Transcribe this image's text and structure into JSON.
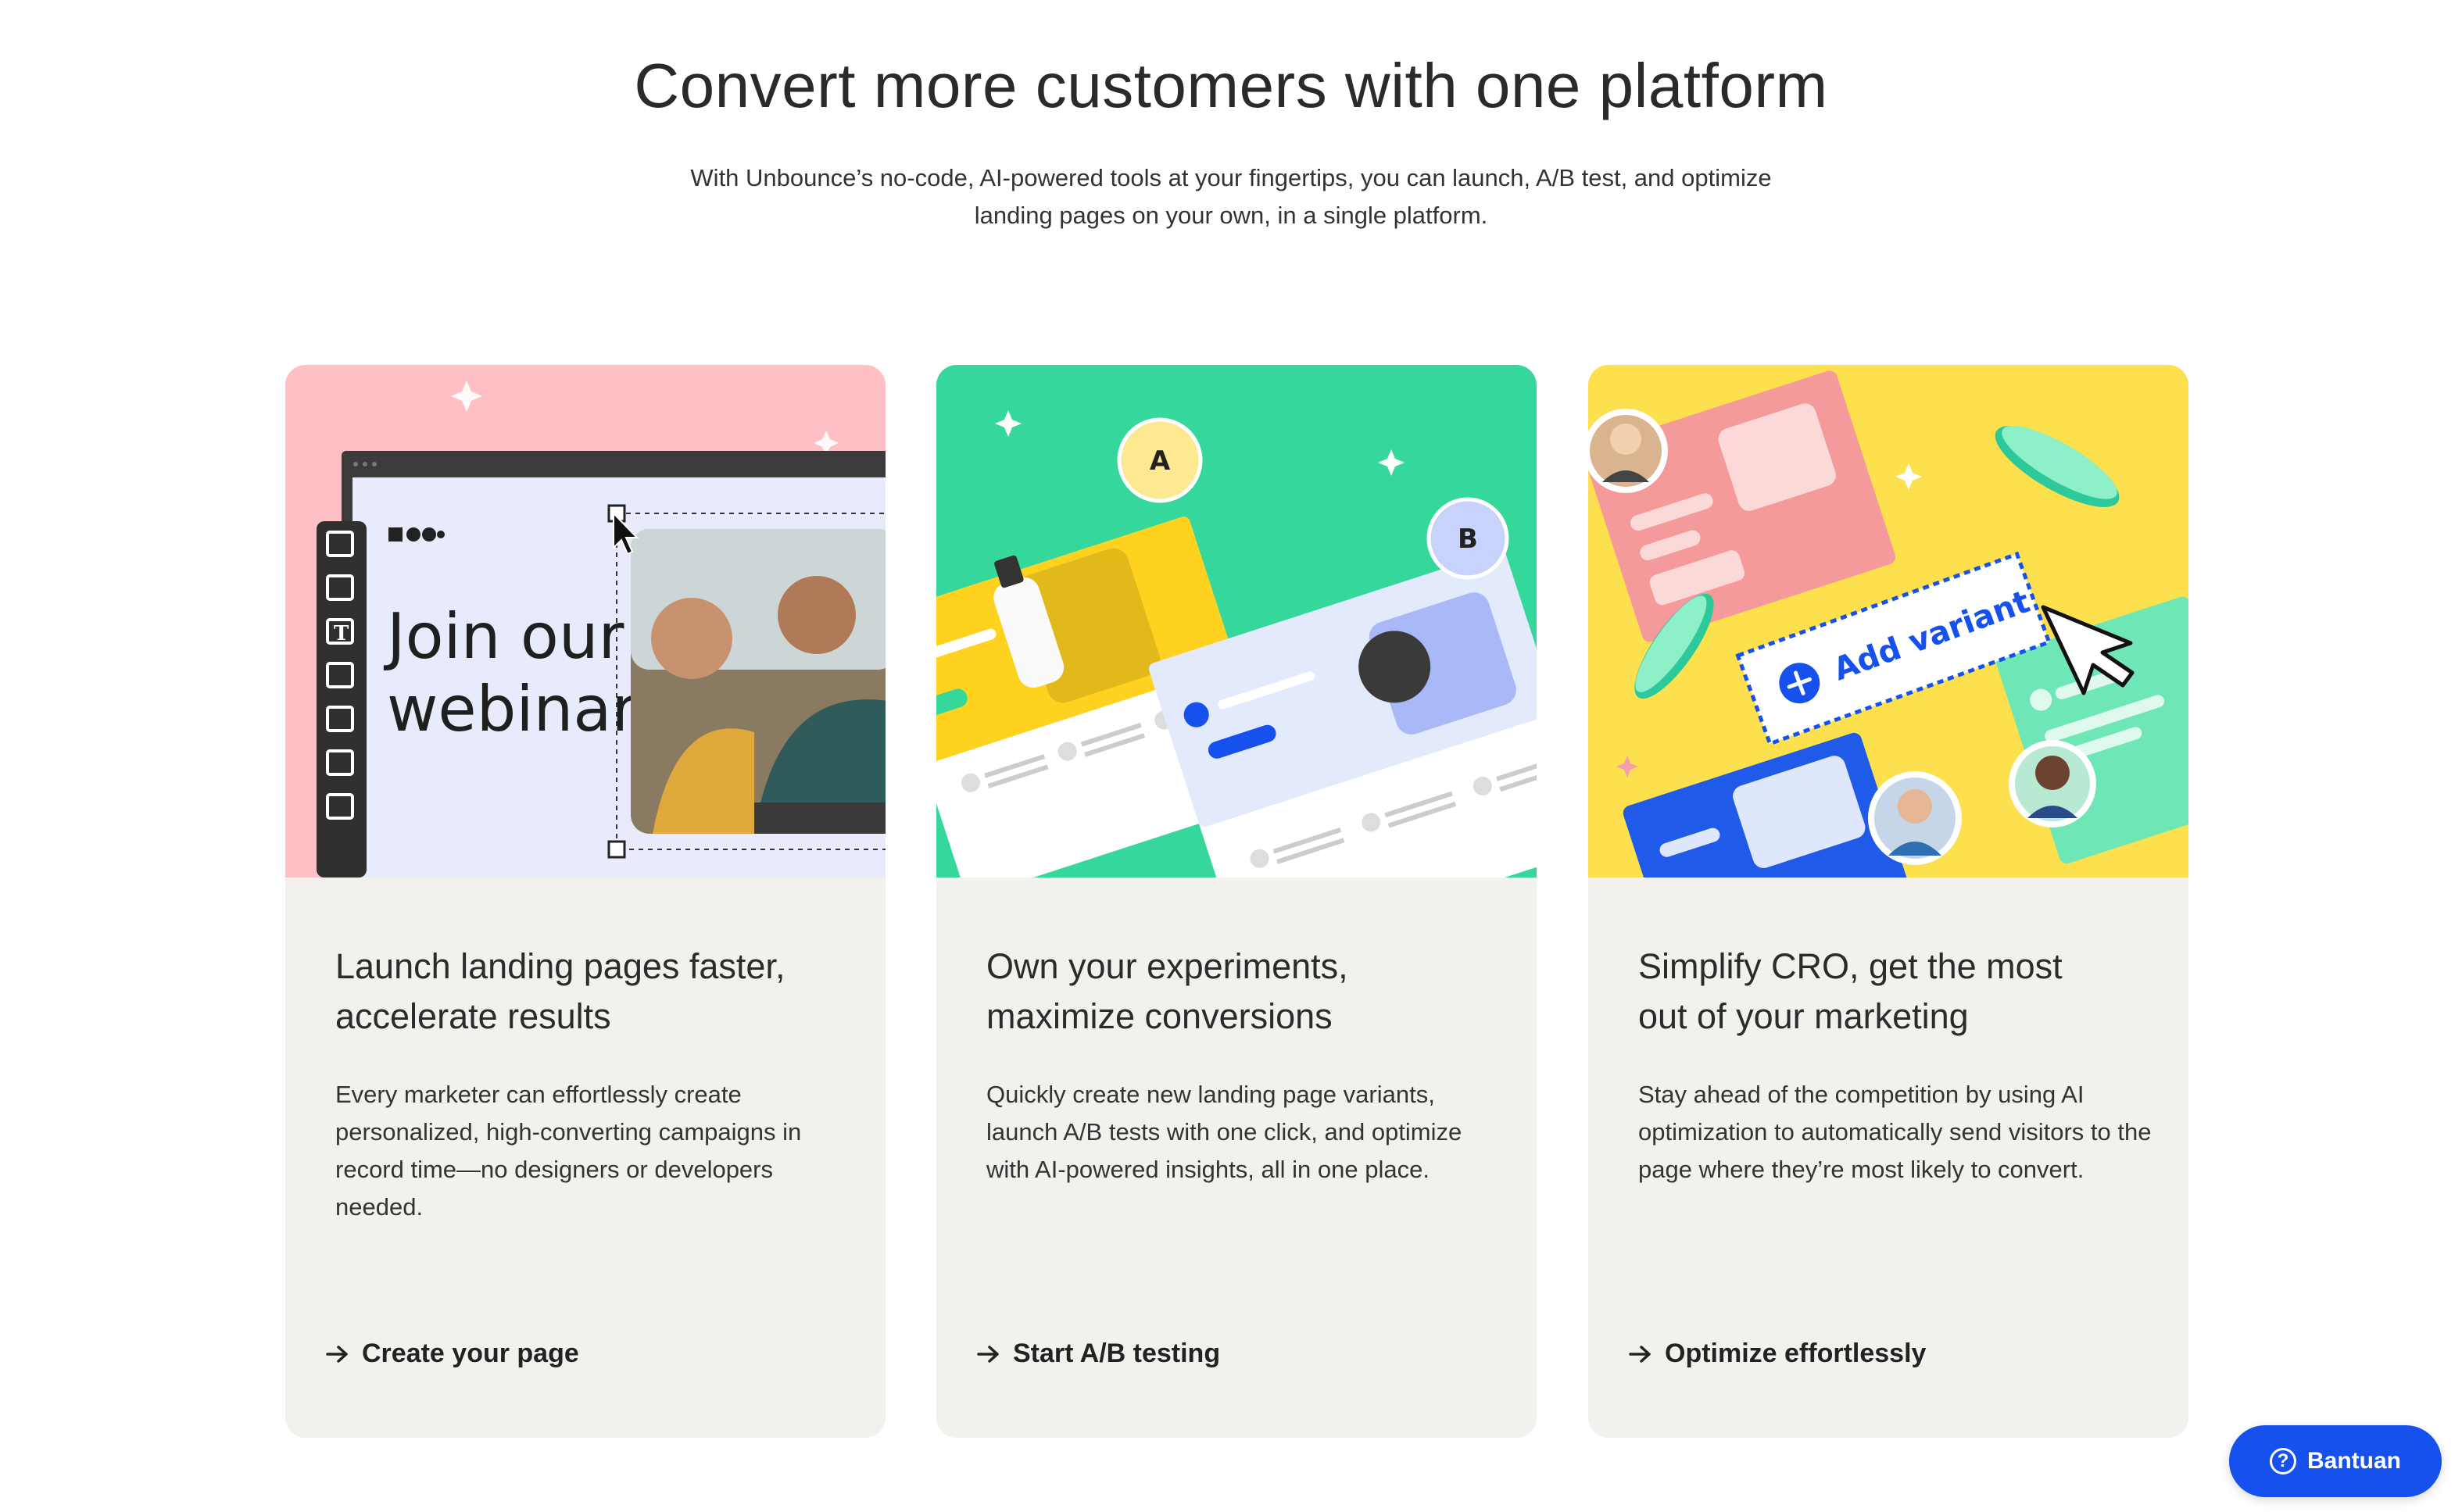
{
  "hero": {
    "title": "Convert more customers with one platform",
    "subtitle_line1": "With Unbounce’s no-code, AI-powered tools at your fingertips, you can launch, A/B test, and optimize",
    "subtitle_line2": "landing pages on your own, in a single platform."
  },
  "cards": [
    {
      "title_line1": "Launch landing pages faster,",
      "title_line2": "accelerate results",
      "description": "Every marketer can effortlessly create personalized, high-converting campaigns in record time—no designers or developers needed.",
      "link": "Create your page",
      "illustration": {
        "headline_line1": "Join our",
        "headline_line2": "webinar",
        "bg_color": "#ffc0c5"
      }
    },
    {
      "title_line1": "Own your experiments,",
      "title_line2": "maximize conversions",
      "description": "Quickly create new landing page variants, launch A/B tests with one click, and optimize with AI-powered insights, all in one place.",
      "link": "Start A/B testing",
      "illustration": {
        "variant_a": "A",
        "variant_b": "B",
        "bg_color": "#35d89a"
      }
    },
    {
      "title_line1": "Simplify CRO, get the most",
      "title_line2": "out of your marketing",
      "description": "Stay ahead of the competition by using AI optimization to automatically send visitors to the page where they’re most likely to convert.",
      "link": "Optimize effortlessly",
      "illustration": {
        "button_label": "Add variant",
        "bg_color": "#fde04e"
      }
    }
  ],
  "help_button": {
    "label": "Bantuan",
    "icon": "question-circle-icon"
  },
  "colors": {
    "accent_blue": "#1651ee",
    "card_bg": "#f2f1ee"
  }
}
